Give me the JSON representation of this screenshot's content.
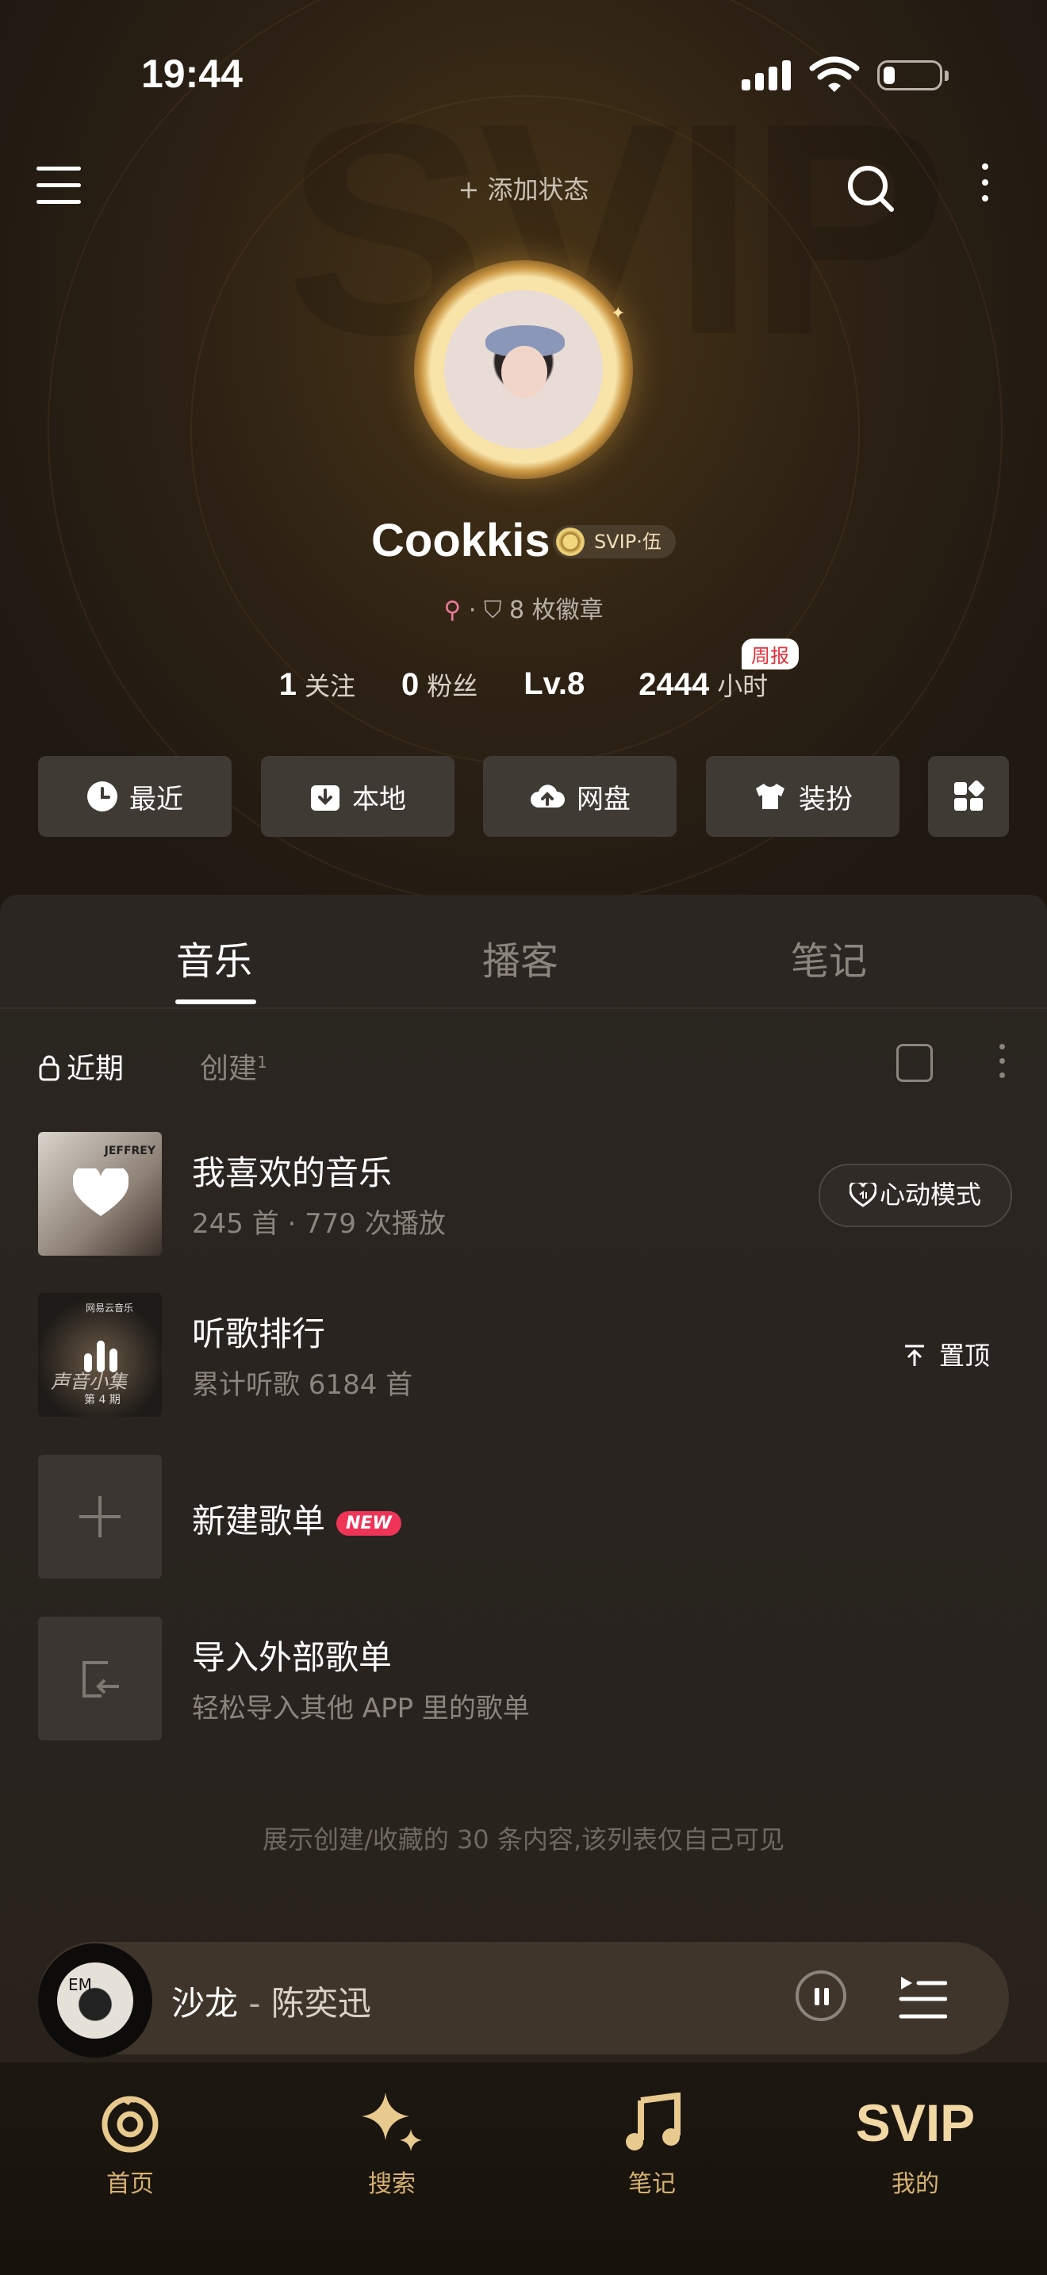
{
  "status_bar": {
    "time": "19:44"
  },
  "header": {
    "add_status": "+ 添加状态"
  },
  "profile": {
    "username": "Cookkis",
    "svip_badge": "SVIP·伍",
    "gender_symbol": "⚲",
    "separator": "·",
    "badges": "8 枚徽章",
    "weekly_tag": "周报",
    "stats": [
      {
        "value": "1",
        "label": "关注"
      },
      {
        "value": "0",
        "label": "粉丝"
      },
      {
        "value": "Lv.8",
        "label": ""
      },
      {
        "value": "2444",
        "label": "小时"
      }
    ]
  },
  "quick_actions": [
    {
      "label": "最近",
      "icon": "clock-icon"
    },
    {
      "label": "本地",
      "icon": "download-icon"
    },
    {
      "label": "网盘",
      "icon": "cloud-upload-icon"
    },
    {
      "label": "装扮",
      "icon": "shirt-icon"
    }
  ],
  "tabs": [
    "音乐",
    "播客",
    "笔记"
  ],
  "subtabs": {
    "recent": "近期",
    "created": "创建",
    "created_count": "1"
  },
  "playlists": [
    {
      "title": "我喜欢的音乐",
      "subtitle": "245 首 · 779 次播放",
      "action": "心动模式"
    },
    {
      "title": "听歌排行",
      "subtitle": "累计听歌 6184 首",
      "action": "置顶"
    },
    {
      "title": "新建歌单",
      "badge": "NEW"
    },
    {
      "title": "导入外部歌单",
      "subtitle": "轻松导入其他 APP 里的歌单"
    }
  ],
  "cover_texts": {
    "liked_cover": "JEFFREY",
    "rank_cover_top": "网易云音乐",
    "rank_cover_mid": "声音小集",
    "rank_cover_bottom": "第 4 期"
  },
  "footnote": "展示创建/收藏的 30 条内容,该列表仅自己可见",
  "player": {
    "song": "沙龙",
    "separator": "-",
    "artist": "陈奕迅",
    "disc_label": "EM"
  },
  "nav": [
    {
      "label": "首页",
      "icon": "netease-logo-icon"
    },
    {
      "label": "搜索",
      "icon": "sparkle-icon"
    },
    {
      "label": "笔记",
      "icon": "music-note-icon"
    },
    {
      "label": "我的",
      "icon": "svip-icon",
      "text": "SVIP"
    }
  ]
}
